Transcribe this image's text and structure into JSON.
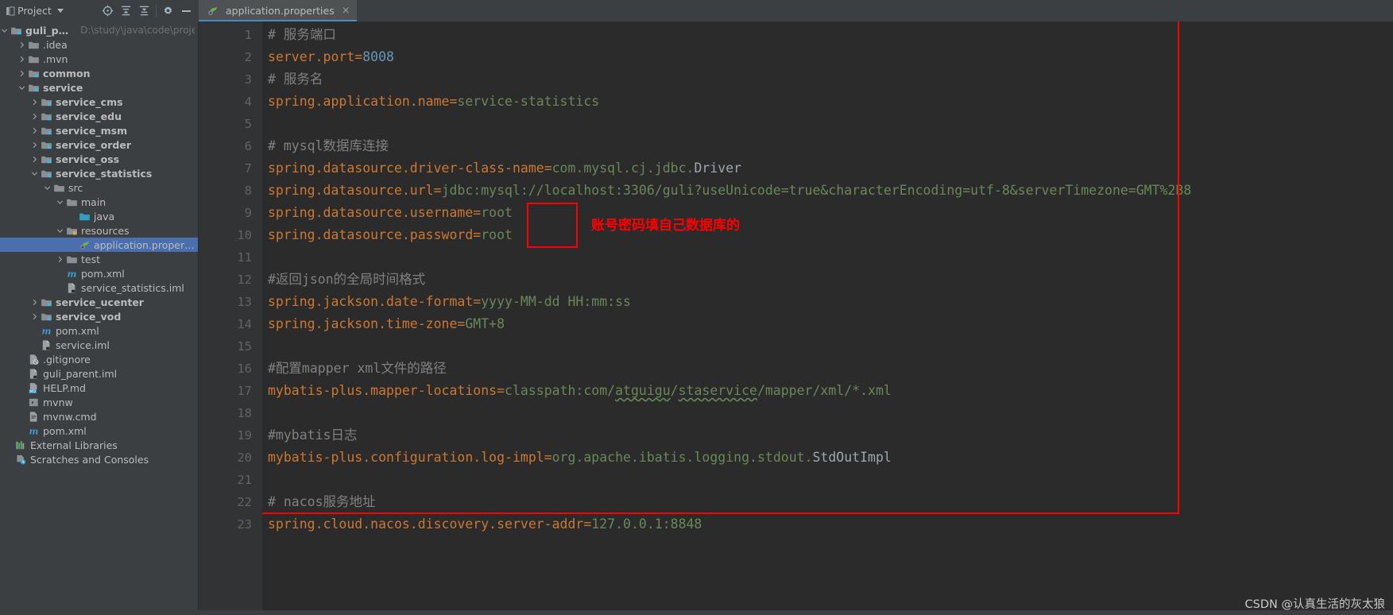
{
  "window": {
    "project_tool_title": "Project",
    "editor_tab_label": "application.properties",
    "close_tab_glyph": "×"
  },
  "toolbar": {
    "locate_icon": "locate-file-icon",
    "expand_icon": "expand-all-icon",
    "collapse_icon": "collapse-all-icon",
    "settings_icon": "gear-icon",
    "hide_icon": "hide-panel-icon"
  },
  "tree": {
    "root_label": "guli_parent",
    "root_path": "D:\\study\\java\\code\\project\\guli",
    "items": [
      {
        "label": ".idea",
        "indent": 1,
        "arrow": "right",
        "icon": "folder",
        "bold": false
      },
      {
        "label": ".mvn",
        "indent": 1,
        "arrow": "right",
        "icon": "folder",
        "bold": false
      },
      {
        "label": "common",
        "indent": 1,
        "arrow": "right",
        "icon": "module",
        "bold": true
      },
      {
        "label": "service",
        "indent": 1,
        "arrow": "down",
        "icon": "module",
        "bold": true
      },
      {
        "label": "service_cms",
        "indent": 2,
        "arrow": "right",
        "icon": "module",
        "bold": true
      },
      {
        "label": "service_edu",
        "indent": 2,
        "arrow": "right",
        "icon": "module",
        "bold": true
      },
      {
        "label": "service_msm",
        "indent": 2,
        "arrow": "right",
        "icon": "module",
        "bold": true
      },
      {
        "label": "service_order",
        "indent": 2,
        "arrow": "right",
        "icon": "module",
        "bold": true
      },
      {
        "label": "service_oss",
        "indent": 2,
        "arrow": "right",
        "icon": "module",
        "bold": true
      },
      {
        "label": "service_statistics",
        "indent": 2,
        "arrow": "down",
        "icon": "module",
        "bold": true
      },
      {
        "label": "src",
        "indent": 3,
        "arrow": "down",
        "icon": "folder",
        "bold": false
      },
      {
        "label": "main",
        "indent": 4,
        "arrow": "down",
        "icon": "folder",
        "bold": false
      },
      {
        "label": "java",
        "indent": 5,
        "arrow": "none",
        "icon": "source-folder",
        "bold": false
      },
      {
        "label": "resources",
        "indent": 4,
        "arrow": "down",
        "icon": "resource-folder",
        "bold": false
      },
      {
        "label": "application.properties",
        "indent": 5,
        "arrow": "none",
        "icon": "spring-file",
        "bold": false,
        "selected": true
      },
      {
        "label": "test",
        "indent": 4,
        "arrow": "right",
        "icon": "folder",
        "bold": false
      },
      {
        "label": "pom.xml",
        "indent": 4,
        "arrow": "none",
        "icon": "maven",
        "bold": false
      },
      {
        "label": "service_statistics.iml",
        "indent": 4,
        "arrow": "none",
        "icon": "iml",
        "bold": false
      },
      {
        "label": "service_ucenter",
        "indent": 2,
        "arrow": "right",
        "icon": "module",
        "bold": true
      },
      {
        "label": "service_vod",
        "indent": 2,
        "arrow": "right",
        "icon": "module",
        "bold": true
      },
      {
        "label": "pom.xml",
        "indent": 2,
        "arrow": "none",
        "icon": "maven",
        "bold": false
      },
      {
        "label": "service.iml",
        "indent": 2,
        "arrow": "none",
        "icon": "iml",
        "bold": false
      },
      {
        "label": ".gitignore",
        "indent": 1,
        "arrow": "none",
        "icon": "gitignore",
        "bold": false
      },
      {
        "label": "guli_parent.iml",
        "indent": 1,
        "arrow": "none",
        "icon": "iml",
        "bold": false
      },
      {
        "label": "HELP.md",
        "indent": 1,
        "arrow": "none",
        "icon": "markdown",
        "bold": false
      },
      {
        "label": "mvnw",
        "indent": 1,
        "arrow": "none",
        "icon": "script",
        "bold": false
      },
      {
        "label": "mvnw.cmd",
        "indent": 1,
        "arrow": "none",
        "icon": "cmd",
        "bold": false
      },
      {
        "label": "pom.xml",
        "indent": 1,
        "arrow": "none",
        "icon": "maven",
        "bold": false
      },
      {
        "label": "External Libraries",
        "indent": 0,
        "arrow": "none",
        "icon": "libraries",
        "bold": false
      },
      {
        "label": "Scratches and Consoles",
        "indent": 0,
        "arrow": "none",
        "icon": "scratches",
        "bold": false
      }
    ]
  },
  "editor": {
    "line_numbers": [
      1,
      2,
      3,
      4,
      5,
      6,
      7,
      8,
      9,
      10,
      11,
      12,
      13,
      14,
      15,
      16,
      17,
      18,
      19,
      20,
      21,
      22,
      23
    ],
    "lines": [
      {
        "n": 1,
        "type": "comment",
        "text": "# 服务端口"
      },
      {
        "n": 2,
        "type": "kv",
        "key": "server.port",
        "value": "8008",
        "value_kind": "number"
      },
      {
        "n": 3,
        "type": "comment",
        "text": "# 服务名"
      },
      {
        "n": 4,
        "type": "kv",
        "key": "spring.application.name",
        "value": "service-statistics",
        "value_kind": "string"
      },
      {
        "n": 5,
        "type": "blank",
        "text": ""
      },
      {
        "n": 6,
        "type": "comment",
        "text": "# mysql数据库连接"
      },
      {
        "n": 7,
        "type": "kv",
        "key": "spring.datasource.driver-class-name",
        "value": "com.mysql.cj.jdbc.Driver",
        "value_kind": "class"
      },
      {
        "n": 8,
        "type": "kv",
        "key": "spring.datasource.url",
        "value": "jdbc:mysql://localhost:3306/guli?useUnicode=true&characterEncoding=utf-8&serverTimezone=GMT%2B8",
        "value_kind": "string"
      },
      {
        "n": 9,
        "type": "kv",
        "key": "spring.datasource.username",
        "value": "root",
        "value_kind": "string"
      },
      {
        "n": 10,
        "type": "kv",
        "key": "spring.datasource.password",
        "value": "root",
        "value_kind": "string"
      },
      {
        "n": 11,
        "type": "blank",
        "text": ""
      },
      {
        "n": 12,
        "type": "comment",
        "text": "#返回json的全局时间格式"
      },
      {
        "n": 13,
        "type": "kv",
        "key": "spring.jackson.date-format",
        "value": "yyyy-MM-dd HH:mm:ss",
        "value_kind": "string"
      },
      {
        "n": 14,
        "type": "kv",
        "key": "spring.jackson.time-zone",
        "value": "GMT+8",
        "value_kind": "string"
      },
      {
        "n": 15,
        "type": "blank",
        "text": ""
      },
      {
        "n": 16,
        "type": "comment",
        "text": "#配置mapper xml文件的路径"
      },
      {
        "n": 17,
        "type": "kv",
        "key": "mybatis-plus.mapper-locations",
        "value": "classpath:com/atguigu/staservice/mapper/xml/*.xml",
        "value_kind": "string"
      },
      {
        "n": 18,
        "type": "blank",
        "text": ""
      },
      {
        "n": 19,
        "type": "comment",
        "text": "#mybatis日志"
      },
      {
        "n": 20,
        "type": "kv",
        "key": "mybatis-plus.configuration.log-impl",
        "value": "org.apache.ibatis.logging.stdout.StdOutImpl",
        "value_kind": "class"
      },
      {
        "n": 21,
        "type": "blank",
        "text": ""
      },
      {
        "n": 22,
        "type": "comment",
        "text": "# nacos服务地址"
      },
      {
        "n": 23,
        "type": "kv",
        "key": "spring.cloud.nacos.discovery.server-addr",
        "value": "127.0.0.1:8848",
        "value_kind": "string"
      }
    ]
  },
  "annotations": {
    "credentials_note": "账号密码填自己数据库的",
    "watermark": "CSDN @认真生活的灰太狼"
  },
  "colors": {
    "annotation_red": "#ff0000",
    "key_orange": "#cc7832",
    "value_green": "#6a8759",
    "number_blue": "#6897bb",
    "comment_gray": "#808080",
    "selection_blue": "#4b6eaf",
    "editor_bg": "#2b2b2b",
    "panel_bg": "#3c3f41"
  }
}
